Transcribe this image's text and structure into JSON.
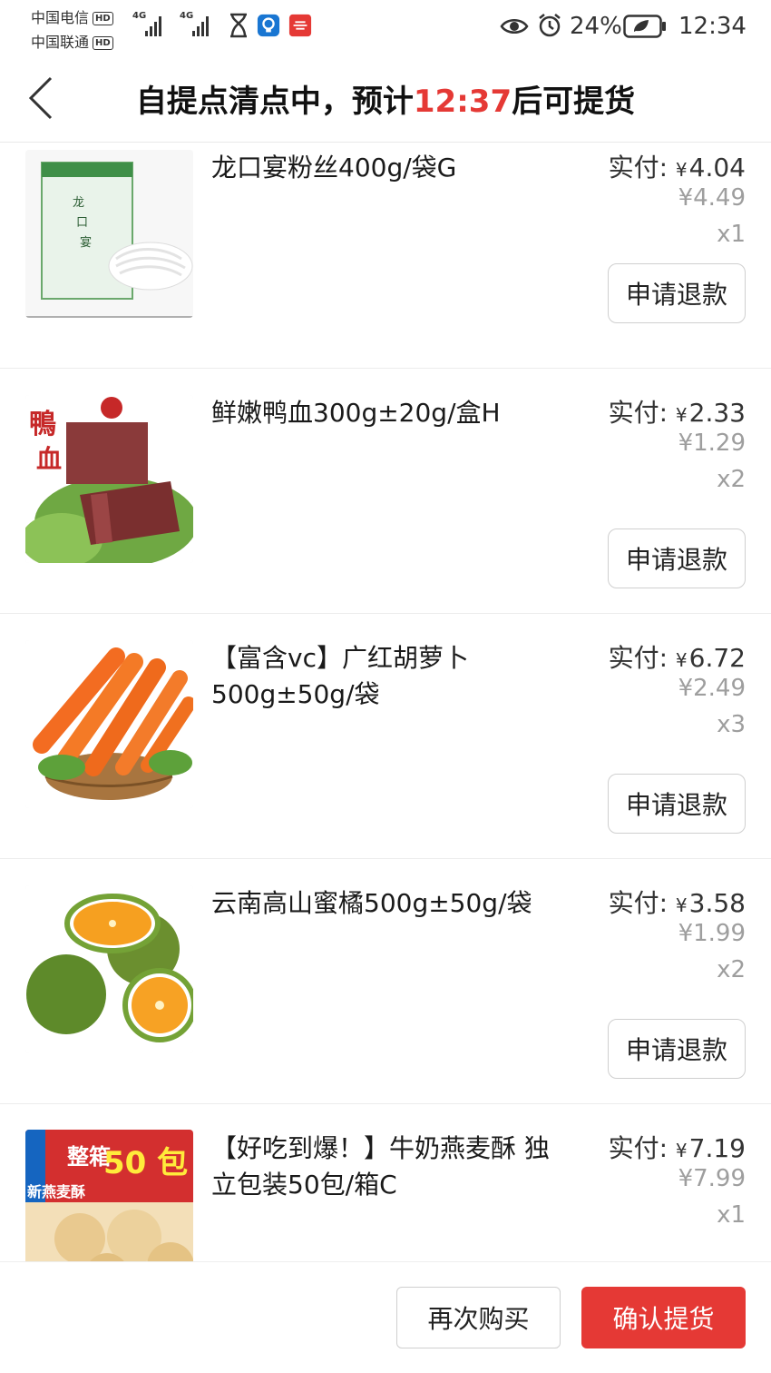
{
  "status_bar": {
    "carrier_1": "中国电信",
    "carrier_2": "中国联通",
    "hd_badge": "HD",
    "network_1": "4G",
    "network_2": "4G",
    "battery": "24%",
    "time": "12:34"
  },
  "header": {
    "title_prefix": "自提点清点中，预计",
    "title_time": "12:37",
    "title_suffix": "后可提货"
  },
  "labels": {
    "paid_label": "实付:",
    "currency": "¥",
    "refund_button": "申请退款"
  },
  "items": [
    {
      "name": "龙口宴粉丝400g/袋G",
      "paid": "4.04",
      "original": "¥4.49",
      "qty": "x1",
      "image": "vermicelli-package"
    },
    {
      "name": "鲜嫩鸭血300g±20g/盒H",
      "paid": "2.33",
      "original": "¥1.29",
      "qty": "x2",
      "image": "duck-blood-tofu"
    },
    {
      "name": "【富含vc】广红胡萝卜500g±50g/袋",
      "paid": "6.72",
      "original": "¥2.49",
      "qty": "x3",
      "image": "carrots-basket"
    },
    {
      "name": "云南高山蜜橘500g±50g/袋",
      "paid": "3.58",
      "original": "¥1.99",
      "qty": "x2",
      "image": "oranges"
    },
    {
      "name": "【好吃到爆！】牛奶燕麦酥 独立包装50包/箱C",
      "paid": "7.19",
      "original": "¥7.99",
      "qty": "x1",
      "image": "oat-crisp-box",
      "box_text_1": "整箱",
      "box_text_2": "50 包",
      "box_text_3": "新燕麦酥"
    }
  ],
  "footer": {
    "rebuy": "再次购买",
    "confirm": "确认提货"
  },
  "colors": {
    "accent_red": "#e53935",
    "muted_gray": "#9e9e9e"
  }
}
